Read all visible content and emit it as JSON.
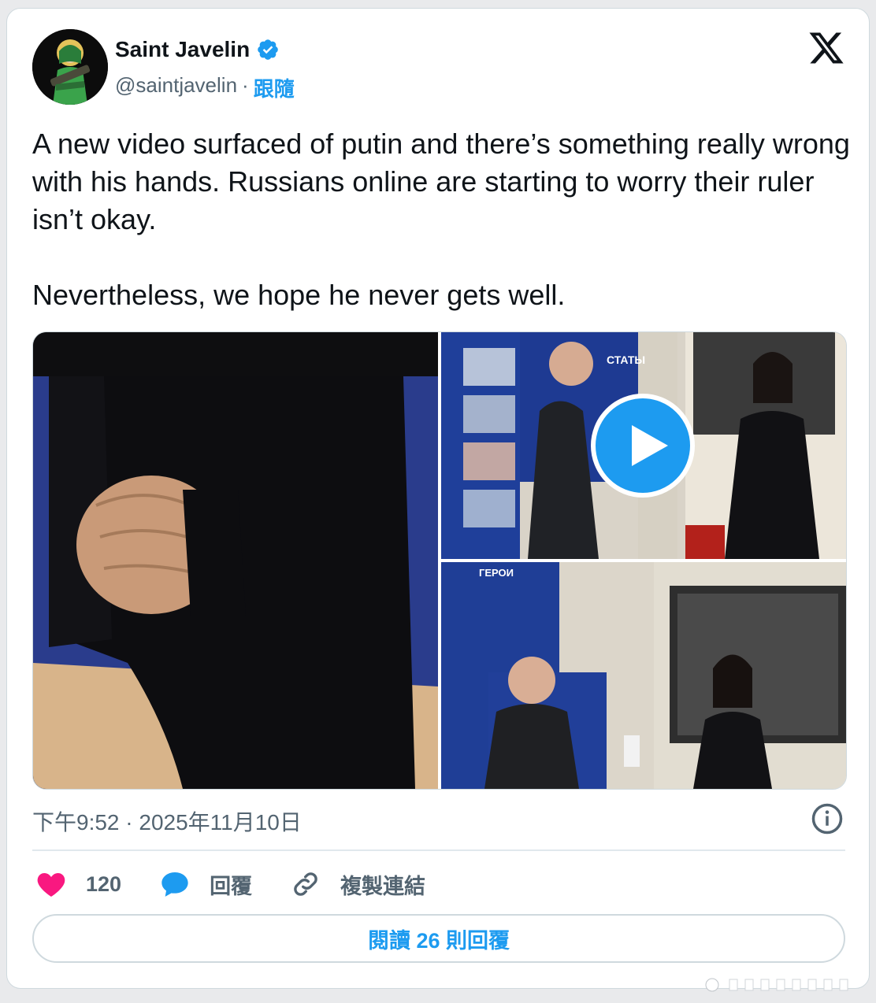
{
  "author": {
    "name": "Saint Javelin",
    "handle": "@saintjavelin",
    "separator": "·",
    "follow_label": "跟隨",
    "verified_icon": "verified-badge-icon"
  },
  "tweet": {
    "text": "A new video surfaced of putin and there’s something really wrong with his hands. Russians online are starting to worry their ruler isn’t okay.\n\nNevertheless, we hope he never gets well.",
    "timestamp": "下午9:52 · 2025年11月10日"
  },
  "media": {
    "count": 3,
    "has_video": true,
    "poster_text": [
      "СТАТЫ",
      "ГЕРОИ"
    ]
  },
  "actions": {
    "likes": "120",
    "reply_label": "回覆",
    "copy_link_label": "複製連結"
  },
  "read_replies_label": "閱讀 26 則回覆",
  "colors": {
    "accent": "#1d9bf0",
    "like": "#f91880",
    "text": "#0f1419",
    "muted": "#536471"
  }
}
